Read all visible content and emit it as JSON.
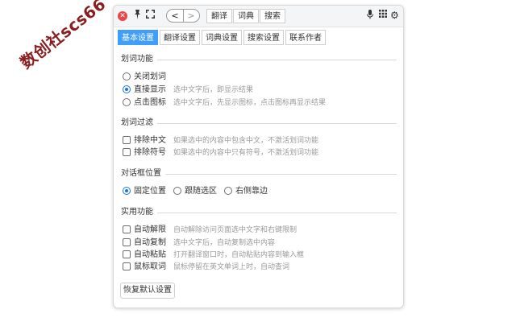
{
  "watermark": "数创社scs66",
  "topbar": {
    "close_glyph": "✕",
    "pin_glyph": "📌",
    "expand_glyph": "⛶",
    "back_glyph": "<",
    "forward_glyph": ">",
    "tabs": [
      "翻译",
      "词典",
      "搜索"
    ],
    "mic_glyph": "🎤",
    "grid_glyph": "▦",
    "gear_glyph": "⚙"
  },
  "tabs": [
    {
      "label": "基本设置",
      "active": true
    },
    {
      "label": "翻译设置",
      "active": false
    },
    {
      "label": "词典设置",
      "active": false
    },
    {
      "label": "搜索设置",
      "active": false
    },
    {
      "label": "联系作者",
      "active": false
    }
  ],
  "sections": {
    "select": {
      "title": "划词功能",
      "options": [
        {
          "label": "关闭划词",
          "desc": "",
          "checked": false
        },
        {
          "label": "直接显示",
          "desc": "选中文字后，即显示结果",
          "checked": true
        },
        {
          "label": "点击图标",
          "desc": "选中文字后，先显示图标，点击图标再显示结果",
          "checked": false
        }
      ]
    },
    "filter": {
      "title": "划词过滤",
      "options": [
        {
          "label": "排除中文",
          "desc": "如果选中的内容中包含中文，不激活划词功能",
          "checked": false
        },
        {
          "label": "排除符号",
          "desc": "如果选中的内容中只有符号，不激活划词功能",
          "checked": false
        }
      ]
    },
    "position": {
      "title": "对话框位置",
      "options": [
        {
          "label": "固定位置",
          "checked": true
        },
        {
          "label": "跟随选区",
          "checked": false
        },
        {
          "label": "右侧靠边",
          "checked": false
        }
      ]
    },
    "utility": {
      "title": "实用功能",
      "options": [
        {
          "label": "自动解限",
          "desc": "自动解除访问页面选中文字和右键限制",
          "checked": false
        },
        {
          "label": "自动复制",
          "desc": "选中文字后，自动复制选中内容",
          "checked": false
        },
        {
          "label": "自动粘贴",
          "desc": "打开翻译窗口时，自动粘贴内容到输入框",
          "checked": false
        },
        {
          "label": "鼠标取词",
          "desc": "鼠标停留在英文单词上时，自动查词",
          "checked": false
        }
      ]
    }
  },
  "reset_label": "恢复默认设置",
  "colors": {
    "accent": "#409eff",
    "close": "#e8464a",
    "radio": "#1a73e8"
  }
}
